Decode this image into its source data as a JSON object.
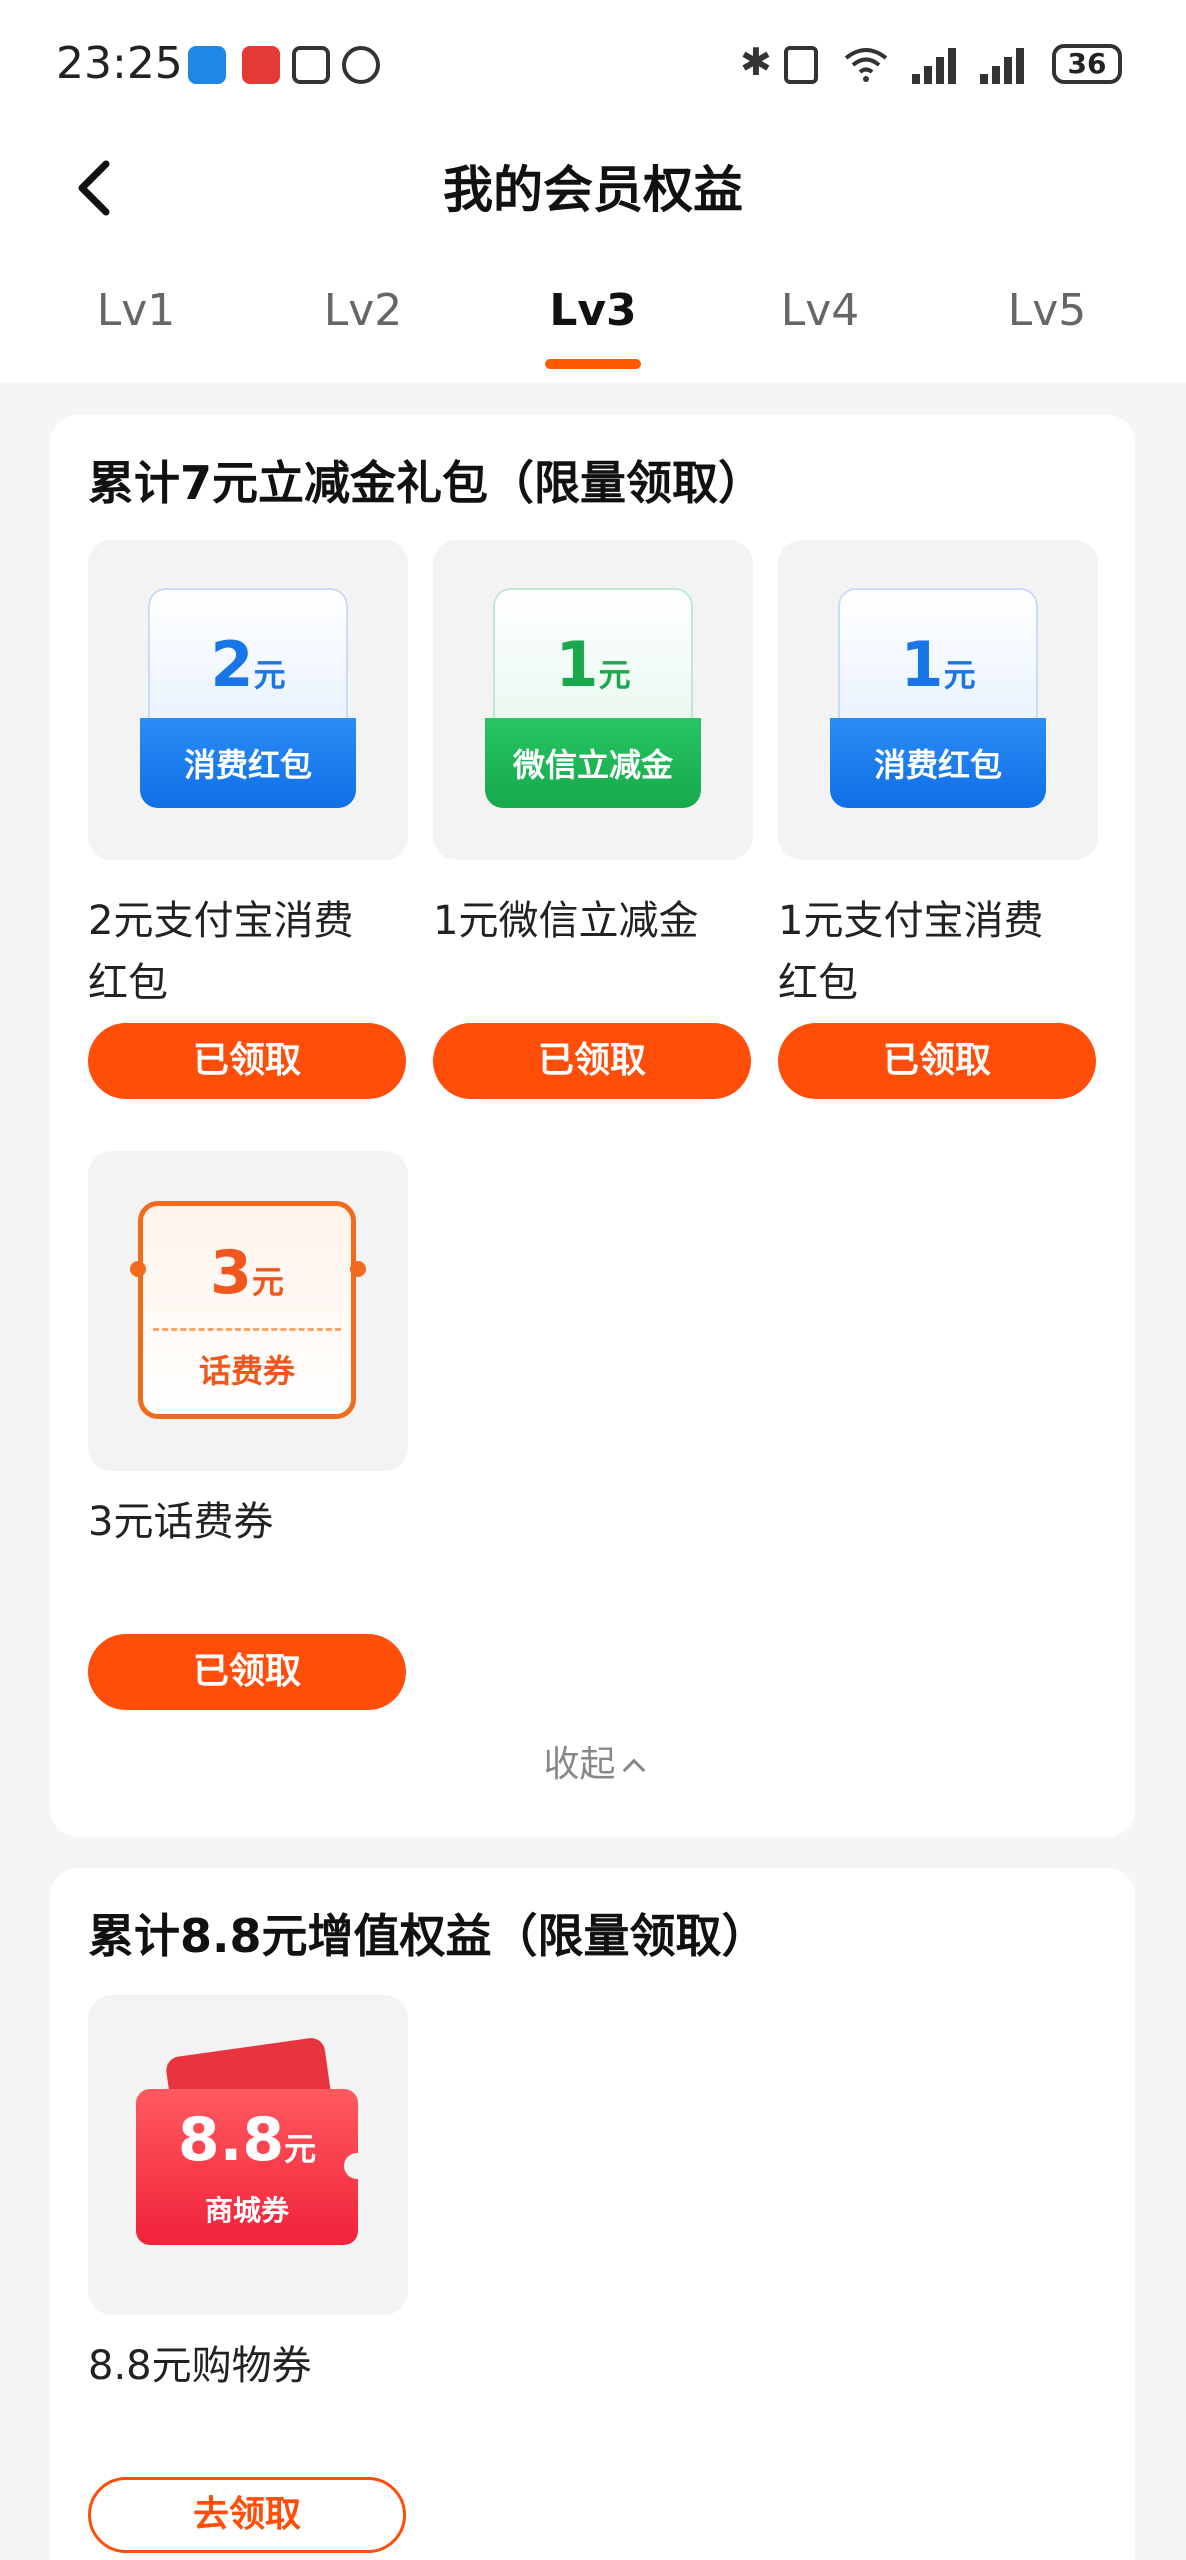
{
  "status_bar": {
    "time": "23:25",
    "battery": "36"
  },
  "header": {
    "title": "我的会员权益"
  },
  "tabs": [
    {
      "label": "Lv1"
    },
    {
      "label": "Lv2"
    },
    {
      "label": "Lv3",
      "active": true
    },
    {
      "label": "Lv4"
    },
    {
      "label": "Lv5"
    }
  ],
  "sections": [
    {
      "title": "累计7元立减金礼包（限量领取）",
      "items": [
        {
          "amount": "2",
          "unit": "元",
          "tag": "消费红包",
          "name_line1": "2元支付宝消费",
          "name_line2": "红包",
          "button": "已领取",
          "style": "blue"
        },
        {
          "amount": "1",
          "unit": "元",
          "tag": "微信立减金",
          "name_line1": "1元微信立减金",
          "name_line2": "",
          "button": "已领取",
          "style": "green"
        },
        {
          "amount": "1",
          "unit": "元",
          "tag": "消费红包",
          "name_line1": "1元支付宝消费",
          "name_line2": "红包",
          "button": "已领取",
          "style": "blue"
        },
        {
          "amount": "3",
          "unit": "元",
          "tag": "话费券",
          "name_line1": "3元话费券",
          "name_line2": "",
          "button": "已领取",
          "style": "orange"
        }
      ],
      "collapse_label": "收起"
    },
    {
      "title": "累计8.8元增值权益（限量领取）",
      "items": [
        {
          "amount": "8.8",
          "unit": "元",
          "tag": "商城券",
          "name_line1": "8.8元购物券",
          "name_line2": "",
          "button": "去领取",
          "style": "red"
        }
      ]
    }
  ],
  "colors": {
    "accent": "#ff4d0a",
    "tab_underline": "#ff5a00",
    "blue_coupon": "#1976e8",
    "green_coupon": "#19a84b",
    "red_coupon": "#f1223a"
  }
}
